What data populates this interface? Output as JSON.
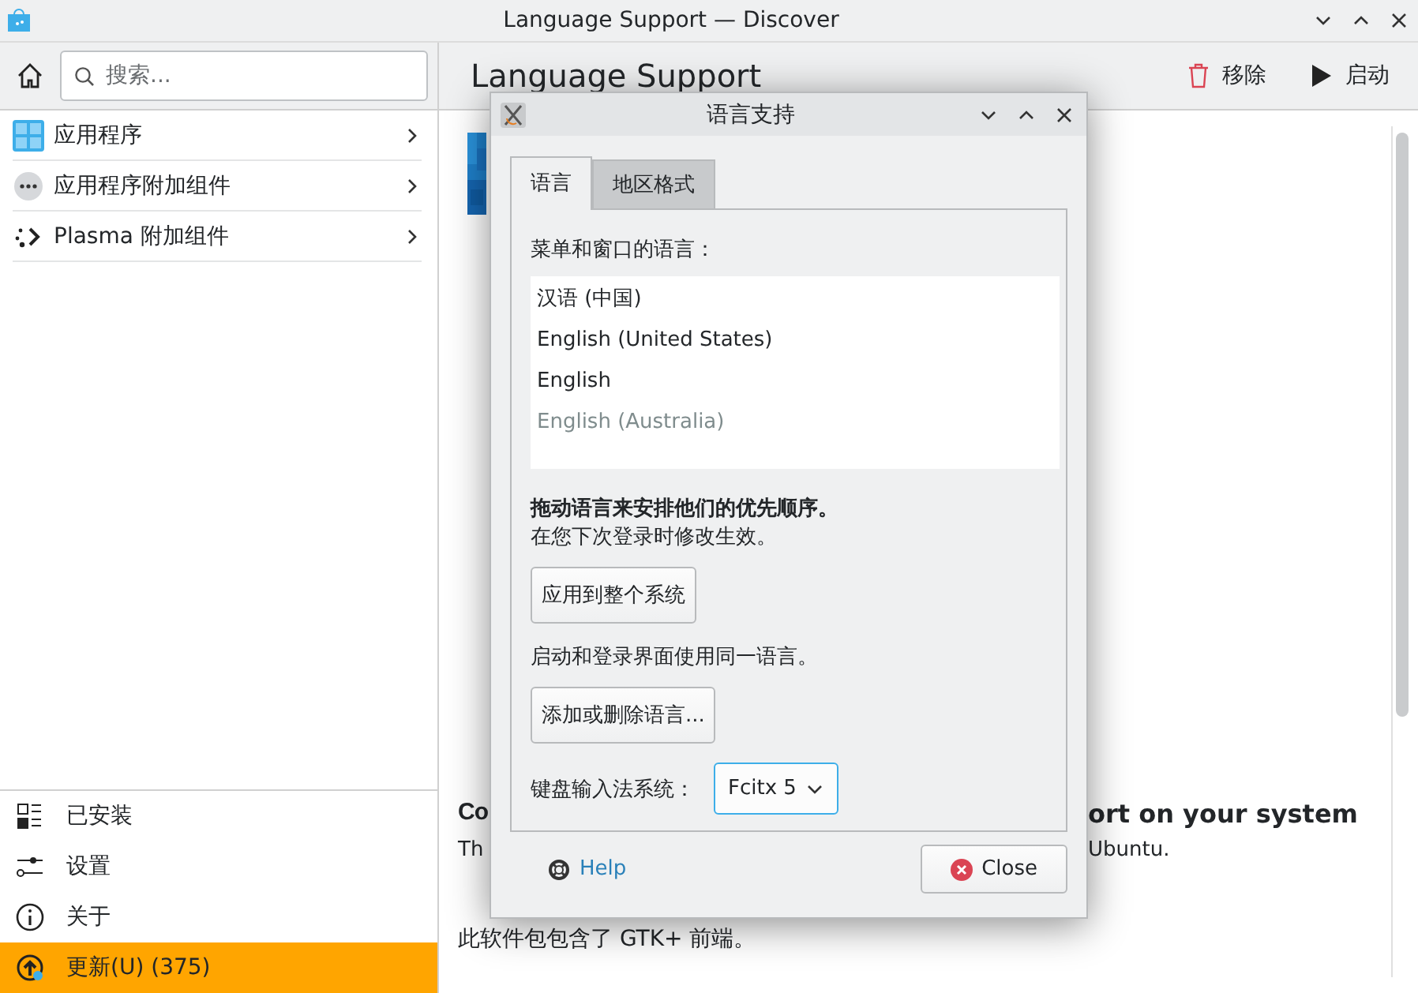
{
  "window": {
    "title": "Language Support — Discover"
  },
  "sidebar": {
    "search": {
      "placeholder": "搜索..."
    },
    "categories": [
      {
        "label": "应用程序",
        "kind": "apps"
      },
      {
        "label": "应用程序附加组件",
        "kind": "addons"
      },
      {
        "label": "Plasma 附加组件",
        "kind": "plasma"
      }
    ],
    "bottom_items": [
      {
        "label": "已安装",
        "kind": "installed",
        "selected": false
      },
      {
        "label": "设置",
        "kind": "settings",
        "selected": false
      },
      {
        "label": "关于",
        "kind": "about",
        "selected": false
      },
      {
        "label": "更新(U) (375)",
        "kind": "update",
        "selected": true
      }
    ]
  },
  "page": {
    "title": "Language Support",
    "actions": [
      {
        "label": "移除",
        "kind": "remove"
      },
      {
        "label": "启动",
        "kind": "launch"
      }
    ],
    "heading_fragments": [
      "Co",
      "ort on your system"
    ],
    "description_fragments": [
      "Th",
      "Ubuntu."
    ],
    "note": "此软件包包含了 GTK+ 前端。"
  },
  "dialog": {
    "title": "语言支持",
    "tabs": [
      {
        "label": "语言",
        "selected": true
      },
      {
        "label": "地区格式",
        "selected": false
      }
    ],
    "list_label": "菜单和窗口的语言：",
    "languages": [
      {
        "label": "汉语 (中国)",
        "dimmed": false
      },
      {
        "label": "English (United States)",
        "dimmed": false
      },
      {
        "label": "English",
        "dimmed": false
      },
      {
        "label": "English (Australia)",
        "dimmed": true
      }
    ],
    "hint_bold": "拖动语言来安排他们的优先顺序。",
    "hint": "在您下次登录时修改生效。",
    "apply_button": "应用到整个系统",
    "apply_hint": "启动和登录界面使用同一语言。",
    "add_button": "添加或删除语言...",
    "input_label": "键盘输入法系统：",
    "input_value": "Fcitx 5",
    "help": "Help",
    "close": "Close"
  }
}
